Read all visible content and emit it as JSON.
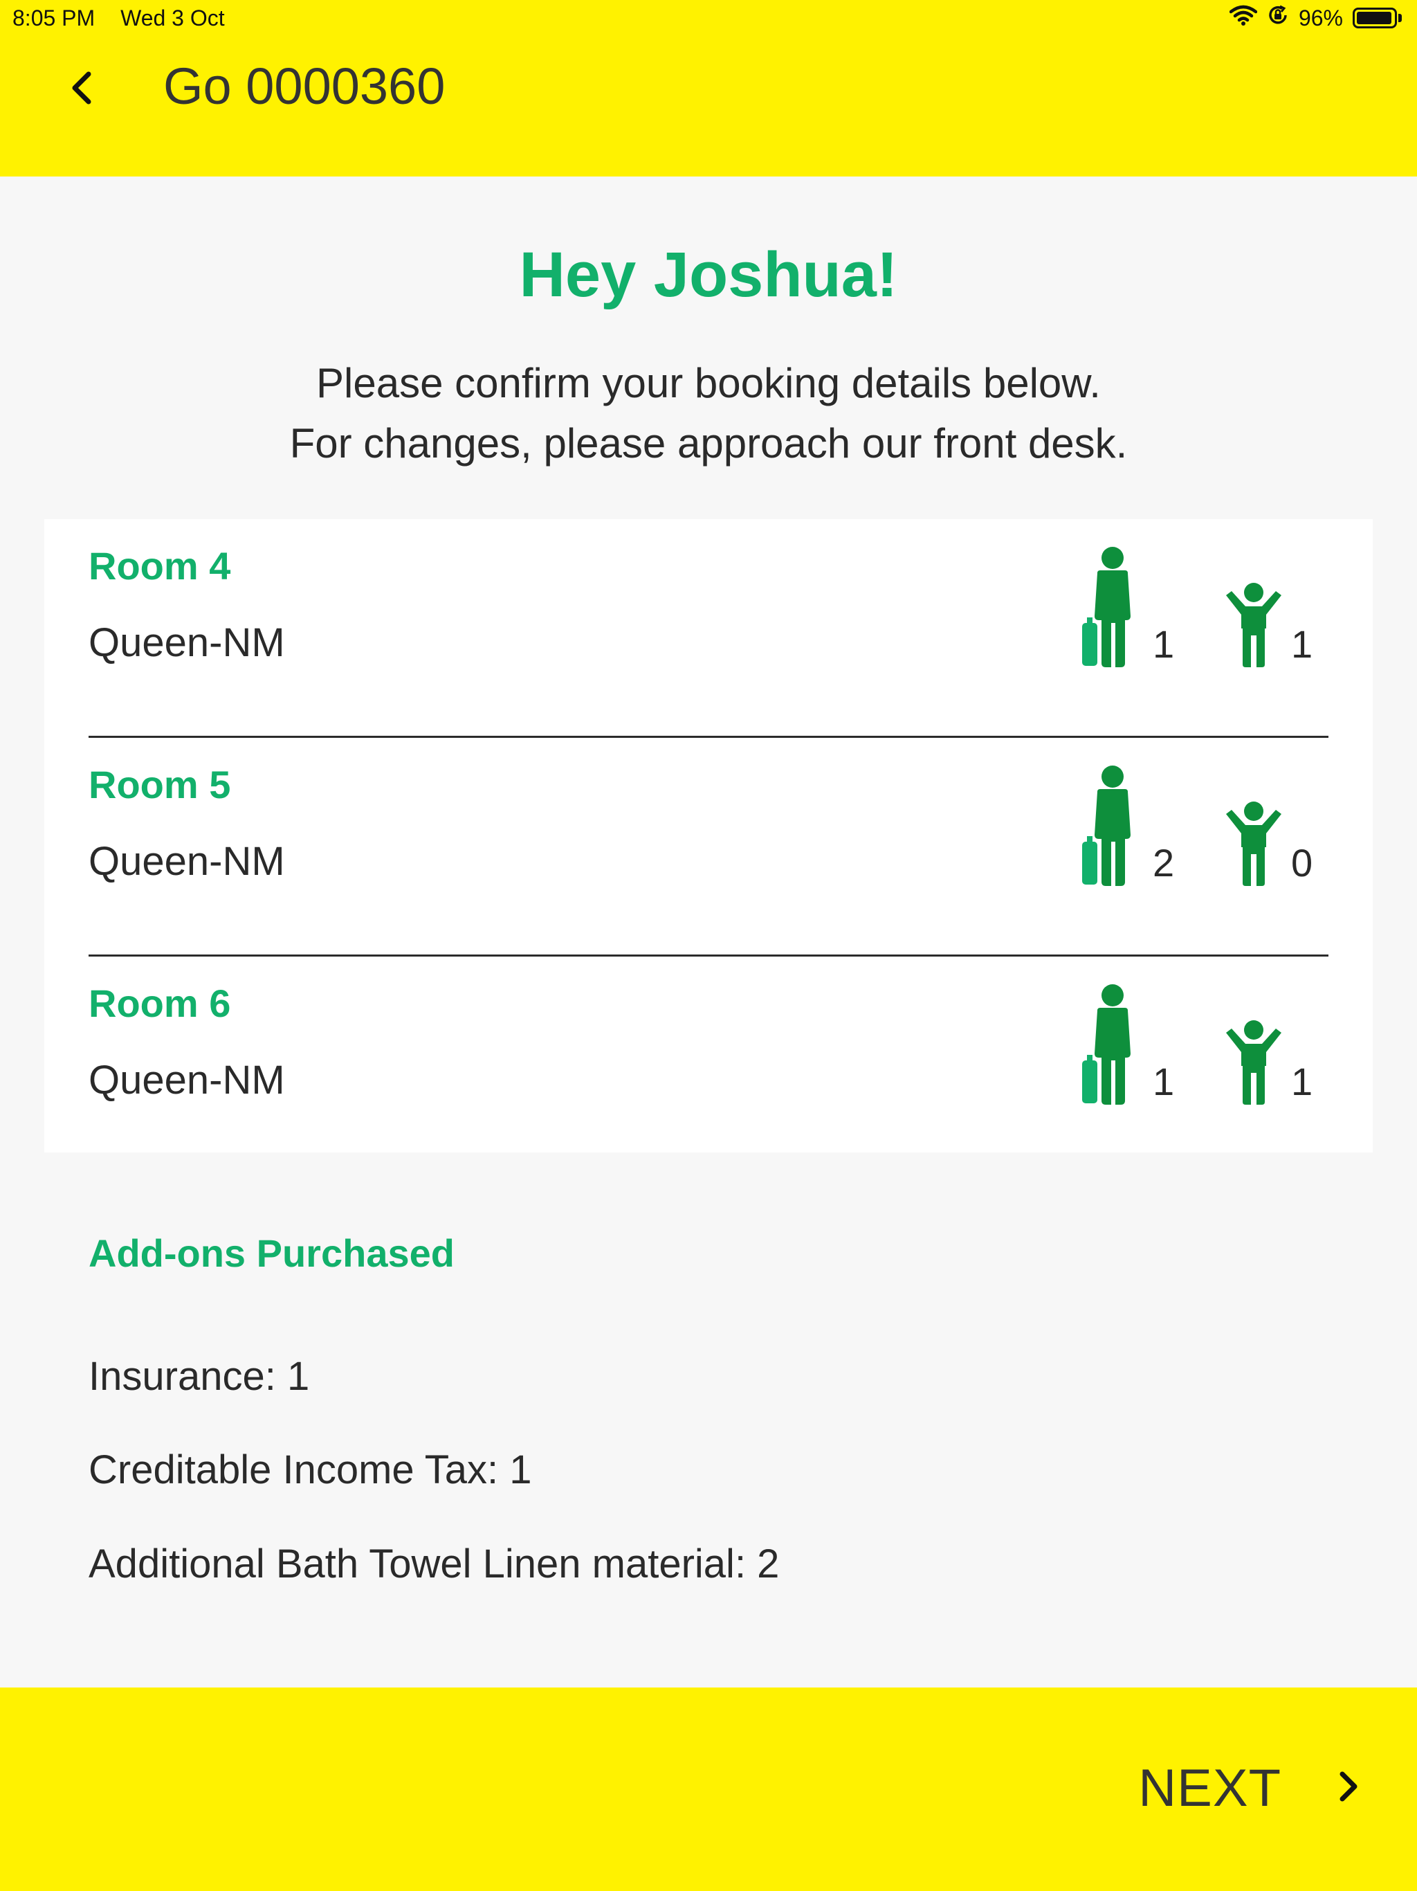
{
  "status_bar": {
    "time": "8:05 PM",
    "date": "Wed 3 Oct",
    "battery": "96%",
    "battery_level": 0.96
  },
  "header": {
    "title": "Go 0000360"
  },
  "greeting": {
    "title": "Hey Joshua!",
    "line1": "Please confirm your booking details below.",
    "line2": "For changes, please approach our front desk."
  },
  "rooms": [
    {
      "name": "Room 4",
      "type": "Queen-NM",
      "adults": "1",
      "children": "1"
    },
    {
      "name": "Room 5",
      "type": "Queen-NM",
      "adults": "2",
      "children": "0"
    },
    {
      "name": "Room 6",
      "type": "Queen-NM",
      "adults": "1",
      "children": "1"
    }
  ],
  "addons": {
    "title": "Add-ons Purchased",
    "items": [
      "Insurance: 1",
      "Creditable Income Tax: 1",
      "Additional Bath Towel Linen material: 2"
    ]
  },
  "footer": {
    "next_label": "NEXT"
  },
  "colors": {
    "brand_yellow": "#fff200",
    "accent_green": "#12b06b",
    "icon_green": "#0e8f3c",
    "background": "#f7f7f7"
  }
}
